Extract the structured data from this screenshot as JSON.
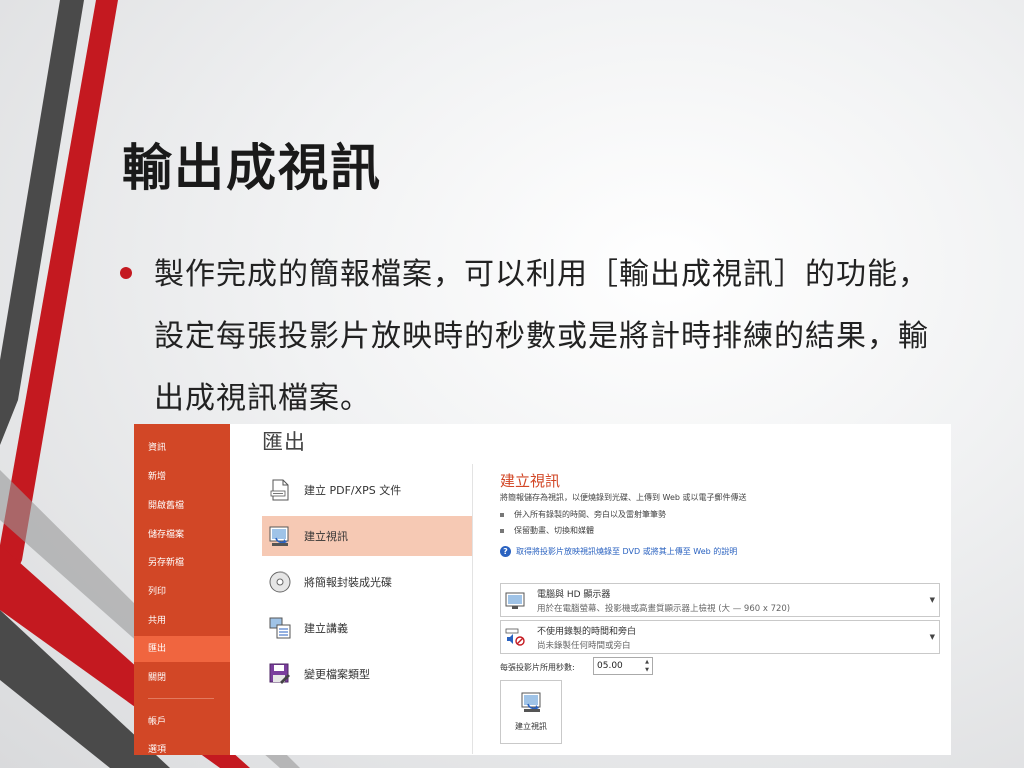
{
  "slide": {
    "title": "輸出成視訊",
    "bullet": "製作完成的簡報檔案，可以利用［輸出成視訊］的功能，設定每張投影片放映時的秒數或是將計時排練的結果，輸出成視訊檔案。"
  },
  "colors": {
    "accent_red": "#c41920",
    "office_orange": "#d24726",
    "selected_option": "#f6c9b4"
  },
  "backstage": {
    "nav": [
      {
        "label": "資訊",
        "active": false
      },
      {
        "label": "新增",
        "active": false
      },
      {
        "label": "開啟舊檔",
        "active": false
      },
      {
        "label": "儲存檔案",
        "active": false
      },
      {
        "label": "另存新檔",
        "active": false
      },
      {
        "label": "列印",
        "active": false
      },
      {
        "label": "共用",
        "active": false
      },
      {
        "label": "匯出",
        "active": true
      },
      {
        "label": "關閉",
        "active": false
      },
      {
        "label": "帳戶",
        "active": false
      },
      {
        "label": "選項",
        "active": false
      }
    ],
    "page_title": "匯出",
    "options": [
      {
        "label": "建立 PDF/XPS 文件",
        "icon": "pdf-document-icon",
        "selected": false
      },
      {
        "label": "建立視訊",
        "icon": "video-icon",
        "selected": true
      },
      {
        "label": "將簡報封裝成光碟",
        "icon": "cd-icon",
        "selected": false
      },
      {
        "label": "建立講義",
        "icon": "handout-icon",
        "selected": false
      },
      {
        "label": "變更檔案類型",
        "icon": "save-as-type-icon",
        "selected": false
      }
    ],
    "detail": {
      "title": "建立視訊",
      "description": "將簡報儲存為視訊，以便燒錄到光碟、上傳到 Web 或以電子郵件傳送",
      "bullets": [
        "併入所有錄製的時間、旁白以及雷射筆筆勢",
        "保留動畫、切換和媒體"
      ],
      "help_link": "取得將投影片放映視訊燒錄至 DVD 或將其上傳至 Web 的說明",
      "quality_dropdown": {
        "main": "電腦與 HD 顯示器",
        "sub": "用於在電腦螢幕、投影機或高畫質顯示器上檢視 (大 — 960 x 720)"
      },
      "timing_dropdown": {
        "main": "不使用錄製的時間和旁白",
        "sub": "尚未錄製任何時間或旁白"
      },
      "seconds_label": "每張投影片所用秒數:",
      "seconds_value": "05.00",
      "create_button": "建立視訊"
    }
  }
}
